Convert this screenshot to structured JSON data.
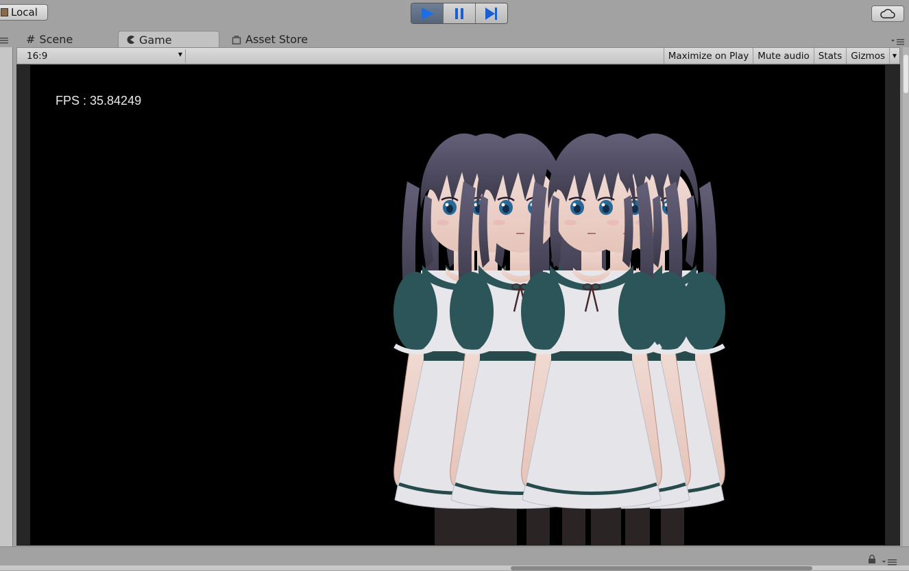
{
  "toolbar": {
    "local_label": "Local",
    "play_icon": "play-icon",
    "pause_icon": "pause-icon",
    "step_icon": "step-icon",
    "cloud_icon": "cloud-icon",
    "play_active_color": "#1a6fe8"
  },
  "tabs": [
    {
      "label": "Scene",
      "icon": "grid-icon"
    },
    {
      "label": "Game",
      "icon": "pacman-icon",
      "active": true
    },
    {
      "label": "Asset Store",
      "icon": "bag-icon"
    }
  ],
  "game_toolbar": {
    "aspect": "16:9",
    "maximize_label": "Maximize on Play",
    "mute_label": "Mute audio",
    "stats_label": "Stats",
    "gizmos_label": "Gizmos"
  },
  "game_view": {
    "fps_text": "FPS : 35.84249",
    "background": "#000000",
    "content": "characters-render"
  }
}
